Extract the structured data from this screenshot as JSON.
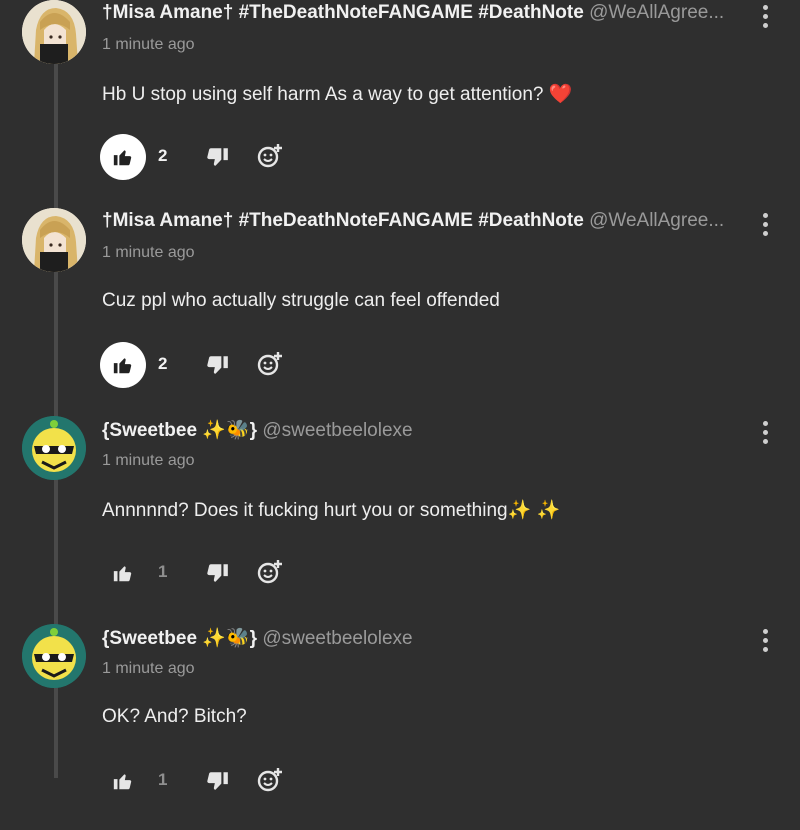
{
  "comments": [
    {
      "display_name": "†Misa Amane† #TheDeathNoteFANGAME #DeathNote",
      "handle": "@WeAllAgree...",
      "timestamp": "1 minute ago",
      "text": "Hb U stop using self  harm As a way to get attention? ❤️",
      "likes": "2",
      "liked": true,
      "avatar": "misa-avatar"
    },
    {
      "display_name": "†Misa Amane† #TheDeathNoteFANGAME #DeathNote",
      "handle": "@WeAllAgree...",
      "timestamp": "1 minute ago",
      "text": "Cuz ppl who actually struggle can feel offended",
      "likes": "2",
      "liked": true,
      "avatar": "misa-avatar"
    },
    {
      "display_name": "{Sweetbee ✨🐝}",
      "handle": "@sweetbeelolexe",
      "timestamp": "1 minute ago",
      "text": "Annnnnd? Does it fucking hurt you or something✨ ✨",
      "likes": "1",
      "liked": false,
      "avatar": "sweetbee-avatar"
    },
    {
      "display_name": "{Sweetbee ✨🐝}",
      "handle": "@sweetbeelolexe",
      "timestamp": "1 minute ago",
      "text": "OK? And? Bitch?",
      "likes": "1",
      "liked": false,
      "avatar": "sweetbee-avatar"
    }
  ],
  "colors": {
    "background": "#2f2f2f",
    "thread_line": "#4a4a4a",
    "liked_bg": "#ffffff",
    "muted_text": "#9a9a9a"
  }
}
